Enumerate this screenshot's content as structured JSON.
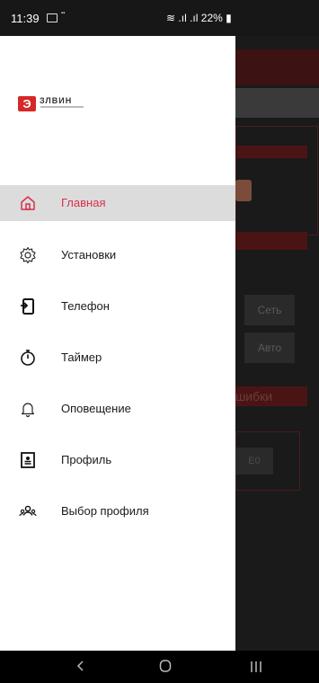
{
  "status_bar": {
    "time": "11:39",
    "right_text": "22%"
  },
  "brand": {
    "name": "ЗЛВИН"
  },
  "drawer": {
    "items": [
      {
        "label": "Главная",
        "icon": "home-icon",
        "active": true
      },
      {
        "label": "Установки",
        "icon": "gear-icon",
        "active": false
      },
      {
        "label": "Телефон",
        "icon": "phone-icon",
        "active": false
      },
      {
        "label": "Таймер",
        "icon": "stopwatch-icon",
        "active": false
      },
      {
        "label": "Оповещение",
        "icon": "bell-icon",
        "active": false
      },
      {
        "label": "Профиль",
        "icon": "profile-icon",
        "active": false
      },
      {
        "label": "Выбор профиля",
        "icon": "users-icon",
        "active": false
      }
    ]
  },
  "background": {
    "btn_network": "Сеть",
    "btn_auto": "Авто",
    "errors_label": "шибки",
    "code_label": "Е0"
  },
  "colors": {
    "accent": "#d6324a",
    "active_bg": "#dcdcdc"
  }
}
